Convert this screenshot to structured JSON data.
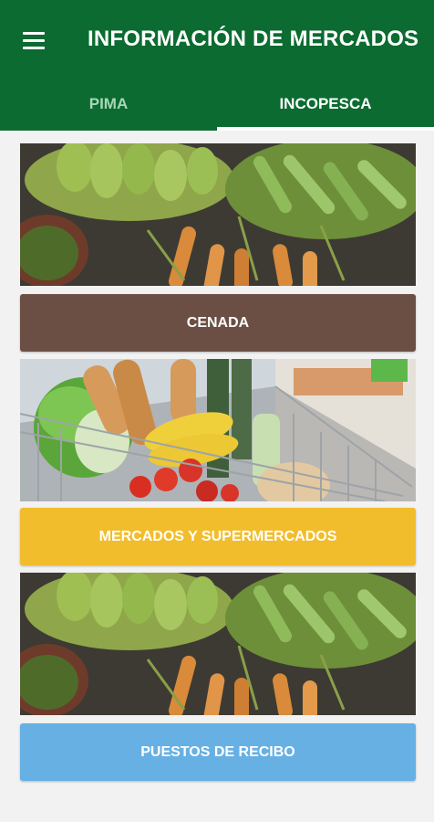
{
  "app_bar": {
    "title": "INFORMACIÓN DE MERCADOS",
    "menu_icon": "hamburger-menu-icon",
    "background_color": "#0b6b30"
  },
  "tabs": [
    {
      "label": "PIMA",
      "selected": false
    },
    {
      "label": "INCOPESCA",
      "selected": true
    }
  ],
  "cards": [
    {
      "image": "vegetables-basket-photo",
      "button_label": "CENADA",
      "button_color": "#6b4f45"
    },
    {
      "image": "shopping-cart-groceries-photo",
      "button_label": "MERCADOS Y SUPERMERCADOS",
      "button_color": "#f2bd2c"
    },
    {
      "image": "vegetables-basket-photo",
      "button_label": "PUESTOS DE RECIBO",
      "button_color": "#66b0e4"
    }
  ]
}
